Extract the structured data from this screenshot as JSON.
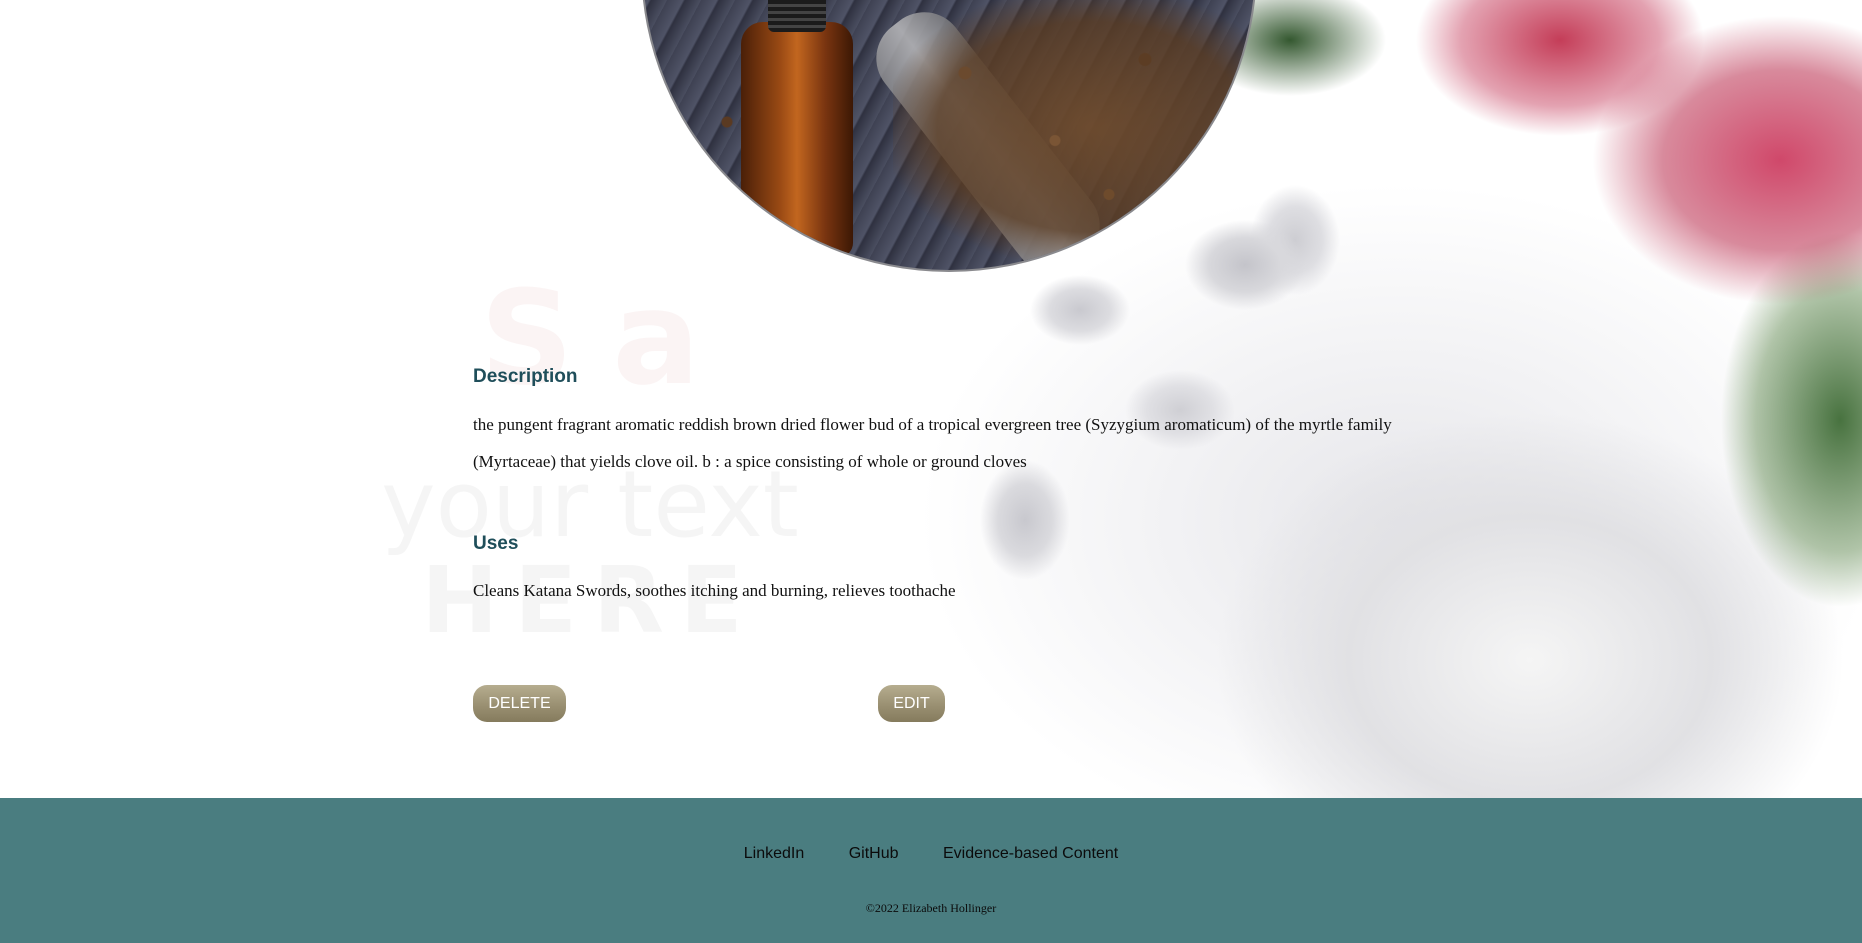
{
  "description": {
    "heading": "Description",
    "text": "the pungent fragrant aromatic reddish brown dried flower bud of a tropical evergreen tree (Syzygium aromaticum) of the myrtle family (Myrtaceae) that yields clove oil. b : a spice consisting of whole or ground cloves"
  },
  "uses": {
    "heading": "Uses",
    "text": "Cleans Katana Swords, soothes itching and burning, relieves toothache"
  },
  "actions": {
    "delete_label": "DELETE",
    "edit_label": "EDIT"
  },
  "footer": {
    "links": [
      "LinkedIn",
      "GitHub",
      "Evidence-based Content"
    ],
    "copyright": "©2022 Elizabeth Hollinger"
  },
  "colors": {
    "heading": "#1f4e5a",
    "button": "#9a9072",
    "footer_bg": "#4a7d80"
  }
}
